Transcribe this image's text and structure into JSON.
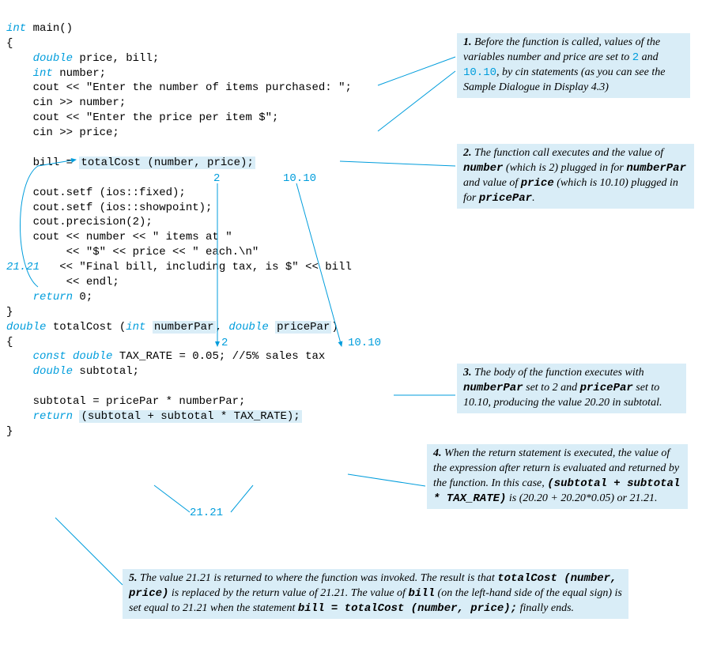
{
  "code": {
    "l1_kw": "int",
    "l1_rest": " main()",
    "l2": "{",
    "l3_kw": "double",
    "l3_rest": " price, bill;",
    "l4_kw": "int",
    "l4_rest": " number;",
    "l5": "    cout << \"Enter the number of items purchased: \";",
    "l6": "    cin >> number;",
    "l7": "    cout << \"Enter the price per item $\";",
    "l8": "    cin >> price;",
    "l10a": "    bill = ",
    "l10_hl": "totalCost (number, price);",
    "l12": "    cout.setf (ios::fixed);",
    "l13": "    cout.setf (ios::showpoint);",
    "l14": "    cout.precision(2);",
    "l15": "    cout << number << \" items at \"",
    "l16": "         << \"$\" << price << \" each.\\n\"",
    "l17a": "21.21",
    "l17b": "   << \"Final bill, including tax, is $\" << bill",
    "l18": "         << endl;",
    "l19_kw": "return",
    "l19_rest": " 0;",
    "l20": "}",
    "l21_kw1": "double",
    "l21_mid1": " totalCost (",
    "l21_kw2": "int",
    "l21_hl1": "numberPar",
    "l21_mid2": ", ",
    "l21_kw3": "double",
    "l21_hl2": "pricePar",
    "l21_end": ")",
    "l22": "{",
    "l23_kw": "const double",
    "l23_rest": " TAX_RATE = 0.05; //5% sales tax",
    "l24_kw": "double",
    "l24_rest": " subtotal;",
    "l26": "    subtotal = pricePar * numberPar;",
    "l27_kw": "return",
    "l27_hl": "(subtotal + subtotal * TAX_RATE);",
    "l28": "}"
  },
  "floats": {
    "f1": "2",
    "f2": "10.10",
    "f3": "2",
    "f4": "10.10",
    "f5": "21.21"
  },
  "ann": {
    "a1_lead": "1.",
    "a1_t1": " Before the function is called, values of the variables number and price are set to ",
    "a1_n1": "2",
    "a1_t2": " and ",
    "a1_n2": "10.10",
    "a1_t3": ", by cin statements (as you can see the Sample Dialogue in Display 4.3)",
    "a2_lead": "2.",
    "a2_t1": " The function call executes and the value of ",
    "a2_b1": "number",
    "a2_t2": " (which is 2) plugged in for ",
    "a2_b2": "numberPar",
    "a2_t3": " and value of ",
    "a2_b3": "price",
    "a2_t4": " (which is 10.10) plugged in for ",
    "a2_b4": "pricePar",
    "a2_t5": ".",
    "a3_lead": "3.",
    "a3_t1": " The body of the function executes with ",
    "a3_b1": "numberPar",
    "a3_t2": " set to 2 and ",
    "a3_b2": "pricePar",
    "a3_t3": " set to 10.10, producing the value 20.20 in subtotal.",
    "a4_lead": "4.",
    "a4_t1": " When the return statement is executed, the value of the expression after return is evaluated and returned by the function. In this case, ",
    "a4_b1": "(subtotal + subtotal * TAX_RATE)",
    "a4_t2": " is (20.20 + 20.20*0.05) or 21.21.",
    "a5_lead": "5.",
    "a5_t1": " The value 21.21 is returned to where the function was invoked. The result is that ",
    "a5_b1": "totalCost (number, price)",
    "a5_t2": " is replaced by the return value of 21.21. The value of ",
    "a5_b2": "bill",
    "a5_t3": " (on the left-hand side of the equal sign) is set equal to 21.21 when the statement ",
    "a5_b3": "bill = totalCost (number, price);",
    "a5_t4": " finally ends."
  }
}
